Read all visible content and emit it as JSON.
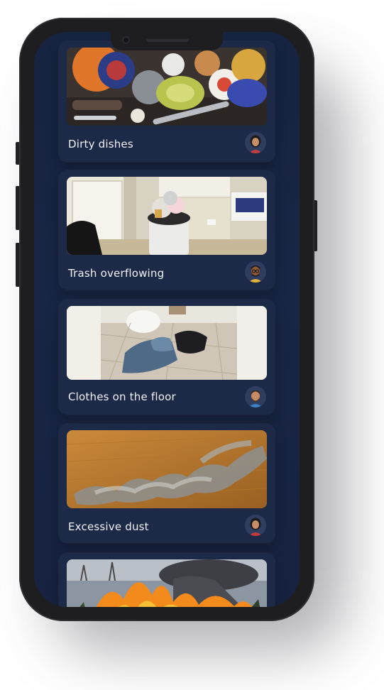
{
  "tasks": [
    {
      "title": "Dirty dishes",
      "photo_icon": "dirty-dishes-photo",
      "avatar_icon": "woman-avatar"
    },
    {
      "title": "Trash overflowing",
      "photo_icon": "trash-photo",
      "avatar_icon": "man-glasses-avatar"
    },
    {
      "title": "Clothes on the floor",
      "photo_icon": "clothes-photo",
      "avatar_icon": "man-beard-avatar"
    },
    {
      "title": "Excessive dust",
      "photo_icon": "dust-photo",
      "avatar_icon": "woman-avatar"
    },
    {
      "title": "",
      "photo_icon": "fire-photo",
      "avatar_icon": ""
    }
  ],
  "colors": {
    "screen_bg": "#172440",
    "card_bg": "#1c2a48",
    "title_text": "#f0f2f7",
    "phone_frame": "#1e1e21"
  }
}
